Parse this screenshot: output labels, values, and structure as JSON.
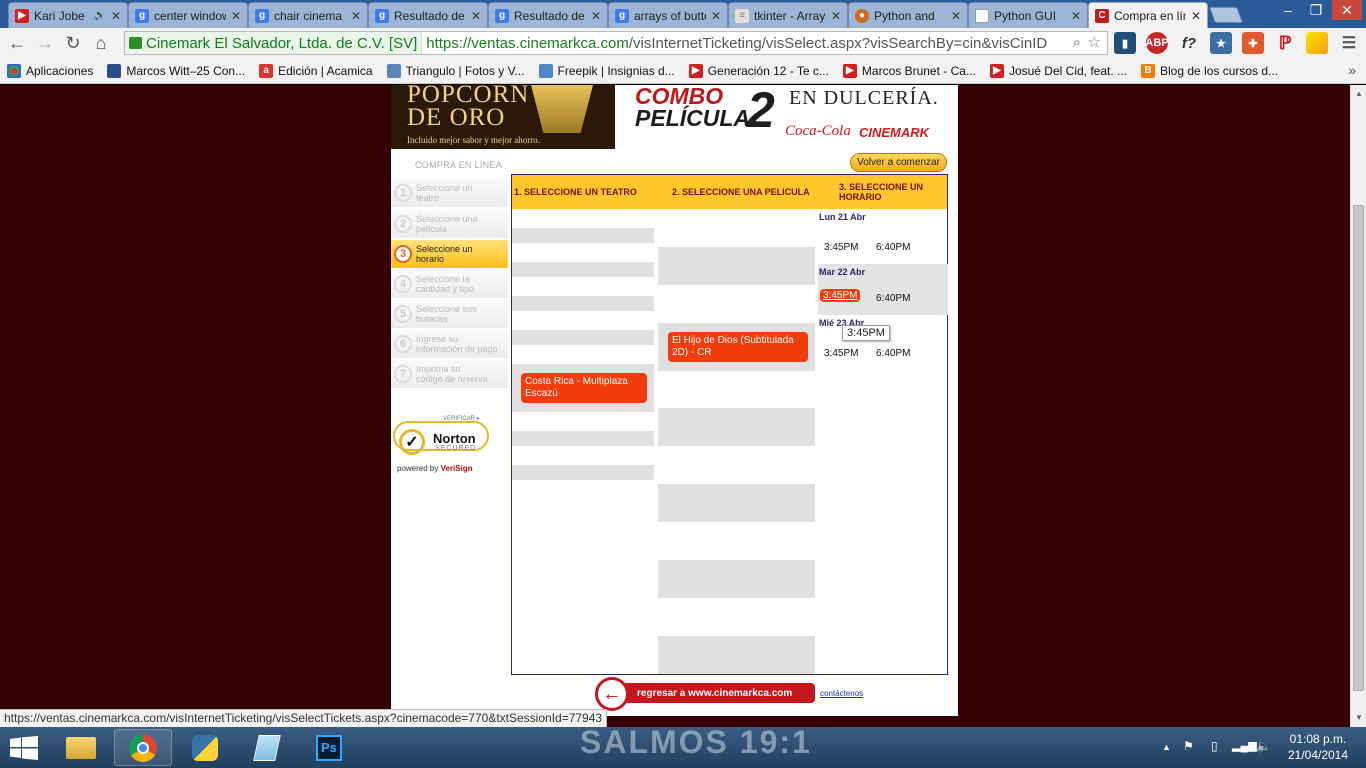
{
  "tabs": [
    {
      "title": "Kari Jobe",
      "icon": "youtube-icon",
      "audio": true
    },
    {
      "title": "center window",
      "icon": "google-icon"
    },
    {
      "title": "chair cinema",
      "icon": "google-icon"
    },
    {
      "title": "Resultado de",
      "icon": "google-icon"
    },
    {
      "title": "Resultado de",
      "icon": "google-icon"
    },
    {
      "title": "arrays of buttons",
      "icon": "google-icon"
    },
    {
      "title": "tkinter - Arrays",
      "icon": "stackoverflow-icon"
    },
    {
      "title": "Python and",
      "icon": "ubuntu-icon"
    },
    {
      "title": "Python GUI",
      "icon": "document-icon"
    },
    {
      "title": "Compra en línea",
      "icon": "cinemark-icon",
      "active": true
    }
  ],
  "toolbar": {
    "ev_name": "Cinemark El Salvador, Ltda. de C.V. [SV]",
    "url_scheme_host": "https://ventas.cinemarkca.com",
    "url_path": "/visInternetTicketing/visSelect.aspx?visSearchBy=cin&visCinID"
  },
  "extensions": [
    "bar-chart-icon",
    "adblock-icon",
    "formula-icon",
    "star-icon",
    "puzzle-icon",
    "pinterest-icon",
    "highlighter-icon"
  ],
  "bookmarks": [
    {
      "label": "Aplicaciones",
      "icon": "apps-icon"
    },
    {
      "label": "Marcos Witt–25 Con...",
      "icon": "bookmark-icon"
    },
    {
      "label": "Edición | Acamica",
      "icon": "acamica-icon"
    },
    {
      "label": "Triangulo | Fotos y V...",
      "icon": "image-icon"
    },
    {
      "label": "Freepik | Insignias d...",
      "icon": "freepik-icon"
    },
    {
      "label": "Generación 12 - Te c...",
      "icon": "youtube-icon"
    },
    {
      "label": "Marcos Brunet - Ca...",
      "icon": "youtube-icon"
    },
    {
      "label": "Josué Del Cid, feat. ...",
      "icon": "youtube-icon"
    },
    {
      "label": "Blog de los cursos d...",
      "icon": "blogger-icon"
    }
  ],
  "banner": {
    "popcorn_line1": "POPCORN",
    "popcorn_line2": "DE ORO",
    "popcorn_small": "Incluido mejor sabor y mejor ahorro.",
    "combo_line1": "COMBO",
    "combo_line2": "PELÍCULA",
    "combo_number": "2",
    "dulceria": "EN DULCERÍA.",
    "cocacola": "Coca-Cola",
    "cinemark": "CINEMARK"
  },
  "sidebar": {
    "title": "COMPRA EN LÍNEA",
    "steps": [
      {
        "num": "1",
        "line1": "Seleccione un",
        "line2": "teatro"
      },
      {
        "num": "2",
        "line1": "Seleccione una",
        "line2": "película"
      },
      {
        "num": "3",
        "line1": "Seleccione un",
        "line2": "horario",
        "active": true
      },
      {
        "num": "4",
        "line1": "Seleccione la",
        "line2": "cantidad y tipo"
      },
      {
        "num": "5",
        "line1": "Seleccione sus",
        "line2": "butacas"
      },
      {
        "num": "6",
        "line1": "Ingrese su",
        "line2": "información de pago"
      },
      {
        "num": "7",
        "line1": "Imprima su",
        "line2": "código de reserva"
      }
    ],
    "norton": {
      "verify": "VERIFICAR ▸",
      "brand": "Norton",
      "secured": "SECURED",
      "powered": "powered by",
      "verisign": "VeriSign"
    }
  },
  "restart_label": "Volver a comenzar",
  "columns": {
    "theater": "1. SELECCIONE UN TEATRO",
    "movie": "2. SELECCIONE UNA PELICULA",
    "schedule_line1": "3. SELECCIONE UN",
    "schedule_line2": "HORARIO"
  },
  "selected_theater": "Costa Rica - Multiplaza Escazú",
  "selected_movie": "El Hijo de Dios (Subtitulada 2D) - CR",
  "schedule": [
    {
      "day": "Lun 21 Abr",
      "times": [
        "3:45PM",
        "6:40PM"
      ]
    },
    {
      "day": "Mar 22 Abr",
      "times": [
        "3:45PM",
        "6:40PM"
      ],
      "selected_time": "3:45PM"
    },
    {
      "day": "Mié 23 Abr",
      "times": [
        "3:45PM",
        "6:40PM"
      ]
    }
  ],
  "tooltip": "3:45PM",
  "footer": {
    "back_label": "regresar a www.cinemarkca.com",
    "contact": "contáctenos"
  },
  "status_url": "https://ventas.cinemarkca.com/visInternetTicketing/visSelectTickets.aspx?cinemacode=770&txtSessionId=77943",
  "taskbar": {
    "wallpaper_text": "SALMOS 19:1",
    "apps": [
      "file-explorer-icon",
      "chrome-icon",
      "python-icon",
      "notepad-icon",
      "photoshop-icon"
    ],
    "time": "01:08 p.m.",
    "date": "21/04/2014"
  },
  "colors": {
    "selection_orange": "#f33c0b",
    "header_yellow": "#ffc72c",
    "page_background": "#350000",
    "cinemark_red": "#c4161c"
  }
}
